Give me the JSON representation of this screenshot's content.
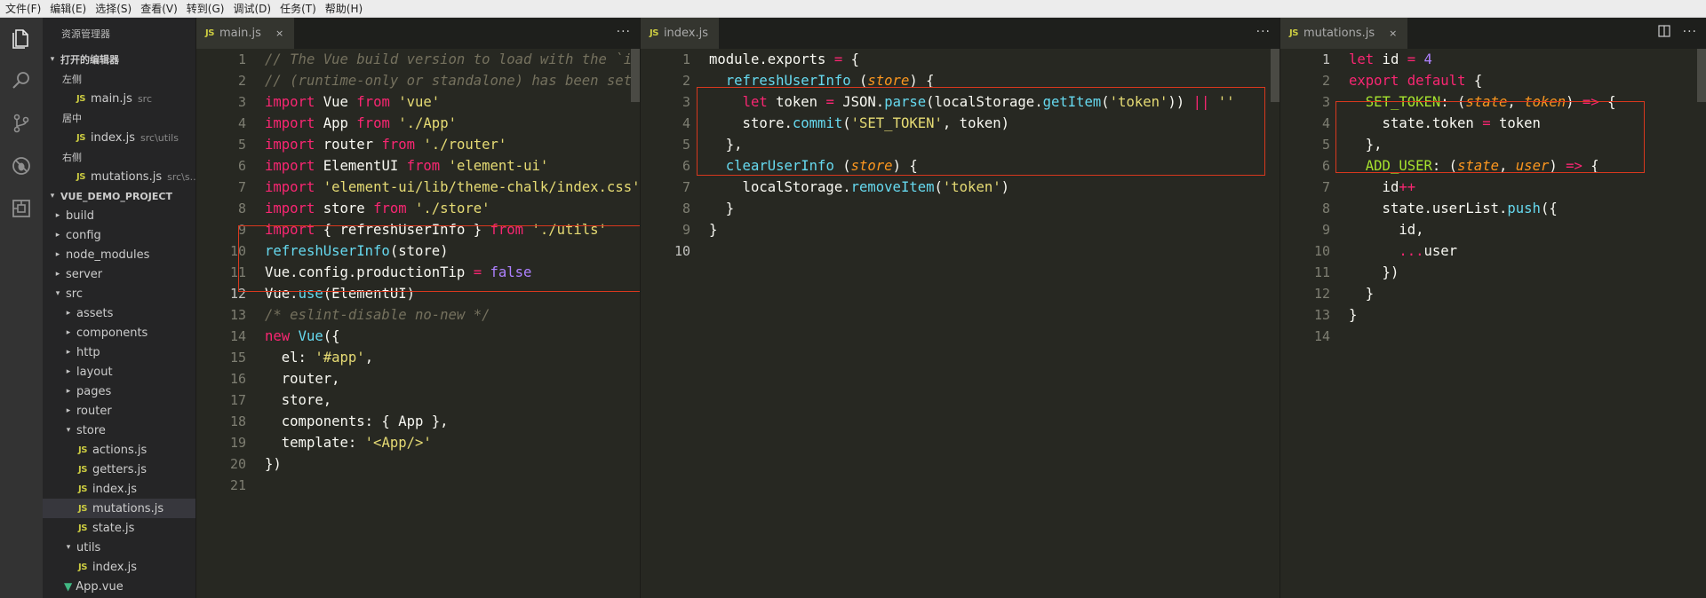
{
  "menu": [
    "文件(F)",
    "编辑(E)",
    "选择(S)",
    "查看(V)",
    "转到(G)",
    "调试(D)",
    "任务(T)",
    "帮助(H)"
  ],
  "activity_icons": [
    "files-icon",
    "search-icon",
    "source-control-icon",
    "debug-icon",
    "extensions-icon"
  ],
  "sidebar": {
    "title": "资源管理器",
    "open_editors_label": "打开的编辑器",
    "groups": [
      {
        "label": "左侧",
        "file": "main.js",
        "desc": "src"
      },
      {
        "label": "居中",
        "file": "index.js",
        "desc": "src\\utils"
      },
      {
        "label": "右侧",
        "file": "mutations.js",
        "desc": "src\\s..."
      }
    ],
    "project_label": "VUE_DEMO_PROJECT",
    "tree": [
      {
        "name": "build",
        "type": "folder",
        "depth": 1,
        "open": false
      },
      {
        "name": "config",
        "type": "folder",
        "depth": 1,
        "open": false
      },
      {
        "name": "node_modules",
        "type": "folder",
        "depth": 1,
        "open": false
      },
      {
        "name": "server",
        "type": "folder",
        "depth": 1,
        "open": false
      },
      {
        "name": "src",
        "type": "folder",
        "depth": 1,
        "open": true
      },
      {
        "name": "assets",
        "type": "folder",
        "depth": 2,
        "open": false
      },
      {
        "name": "components",
        "type": "folder",
        "depth": 2,
        "open": false
      },
      {
        "name": "http",
        "type": "folder",
        "depth": 2,
        "open": false
      },
      {
        "name": "layout",
        "type": "folder",
        "depth": 2,
        "open": false
      },
      {
        "name": "pages",
        "type": "folder",
        "depth": 2,
        "open": false
      },
      {
        "name": "router",
        "type": "folder",
        "depth": 2,
        "open": false
      },
      {
        "name": "store",
        "type": "folder",
        "depth": 2,
        "open": true
      },
      {
        "name": "actions.js",
        "type": "js",
        "depth": 3
      },
      {
        "name": "getters.js",
        "type": "js",
        "depth": 3
      },
      {
        "name": "index.js",
        "type": "js",
        "depth": 3
      },
      {
        "name": "mutations.js",
        "type": "js",
        "depth": 3,
        "selected": true
      },
      {
        "name": "state.js",
        "type": "js",
        "depth": 3
      },
      {
        "name": "utils",
        "type": "folder",
        "depth": 2,
        "open": true
      },
      {
        "name": "index.js",
        "type": "js",
        "depth": 3
      },
      {
        "name": "App.vue",
        "type": "vue",
        "depth": 2
      }
    ]
  },
  "editors": [
    {
      "tab": "main.js",
      "tab_close": "×",
      "current_line": 12,
      "lines": [
        [
          [
            "cm",
            "// The Vue build version to load with the `import` command"
          ]
        ],
        [
          [
            "cm",
            "// (runtime-only or standalone) has been set in webpack.base.conf with an alias."
          ]
        ],
        [
          [
            "kw",
            "import"
          ],
          [
            "pl",
            " Vue "
          ],
          [
            "kw",
            "from"
          ],
          [
            "pl",
            " "
          ],
          [
            "str",
            "'vue'"
          ]
        ],
        [
          [
            "kw",
            "import"
          ],
          [
            "pl",
            " App "
          ],
          [
            "kw",
            "from"
          ],
          [
            "pl",
            " "
          ],
          [
            "str",
            "'./App'"
          ]
        ],
        [
          [
            "kw",
            "import"
          ],
          [
            "pl",
            " router "
          ],
          [
            "kw",
            "from"
          ],
          [
            "pl",
            " "
          ],
          [
            "str",
            "'./router'"
          ]
        ],
        [
          [
            "kw",
            "import"
          ],
          [
            "pl",
            " ElementUI "
          ],
          [
            "kw",
            "from"
          ],
          [
            "pl",
            " "
          ],
          [
            "str",
            "'element-ui'"
          ]
        ],
        [
          [
            "kw",
            "import"
          ],
          [
            "pl",
            " "
          ],
          [
            "str",
            "'element-ui/lib/theme-chalk/index.css'"
          ]
        ],
        [
          [
            "kw",
            "import"
          ],
          [
            "pl",
            " store "
          ],
          [
            "kw",
            "from"
          ],
          [
            "pl",
            " "
          ],
          [
            "str",
            "'./store'"
          ]
        ],
        [
          [
            "kw",
            "import"
          ],
          [
            "pl",
            " { refreshUserInfo } "
          ],
          [
            "kw",
            "from"
          ],
          [
            "pl",
            " "
          ],
          [
            "str",
            "'./utils'"
          ]
        ],
        [
          [
            "fn",
            "refreshUserInfo"
          ],
          [
            "pl",
            "(store)"
          ]
        ],
        [
          [
            "pl",
            "Vue.config.productionTip "
          ],
          [
            "kw",
            "="
          ],
          [
            "pl",
            " "
          ],
          [
            "nm",
            "false"
          ]
        ],
        [
          [
            "pl",
            "Vue."
          ],
          [
            "fn",
            "use"
          ],
          [
            "pl",
            "(ElementUI)"
          ]
        ],
        [
          [
            "cm",
            "/* eslint-disable no-new */"
          ]
        ],
        [
          [
            "kw",
            "new"
          ],
          [
            "pl",
            " "
          ],
          [
            "fn",
            "Vue"
          ],
          [
            "pl",
            "({"
          ]
        ],
        [
          [
            "pl",
            "  el: "
          ],
          [
            "str",
            "'#app'"
          ],
          [
            "pl",
            ","
          ]
        ],
        [
          [
            "pl",
            "  router,"
          ]
        ],
        [
          [
            "pl",
            "  store,"
          ]
        ],
        [
          [
            "pl",
            "  components: { App },"
          ]
        ],
        [
          [
            "pl",
            "  template: "
          ],
          [
            "str",
            "'<App/>'"
          ]
        ],
        [
          [
            "pl",
            "})"
          ]
        ],
        []
      ]
    },
    {
      "tab": "index.js",
      "current_line": 10,
      "lines": [
        [
          [
            "pl",
            "module.exports "
          ],
          [
            "kw",
            "="
          ],
          [
            "pl",
            " {"
          ]
        ],
        [
          [
            "pl",
            "  "
          ],
          [
            "fn",
            "refreshUserInfo"
          ],
          [
            "pl",
            " ("
          ],
          [
            "pa",
            "store"
          ],
          [
            "pl",
            ") {"
          ]
        ],
        [
          [
            "pl",
            "    "
          ],
          [
            "kw",
            "let"
          ],
          [
            "pl",
            " token "
          ],
          [
            "kw",
            "="
          ],
          [
            "pl",
            " JSON."
          ],
          [
            "fn",
            "parse"
          ],
          [
            "pl",
            "(localStorage."
          ],
          [
            "fn",
            "getItem"
          ],
          [
            "pl",
            "("
          ],
          [
            "str",
            "'token'"
          ],
          [
            "pl",
            ")) "
          ],
          [
            "kw",
            "||"
          ],
          [
            "pl",
            " "
          ],
          [
            "str",
            "''"
          ]
        ],
        [
          [
            "pl",
            "    store."
          ],
          [
            "fn",
            "commit"
          ],
          [
            "pl",
            "("
          ],
          [
            "str",
            "'SET_TOKEN'"
          ],
          [
            "pl",
            ", token)"
          ]
        ],
        [
          [
            "pl",
            "  },"
          ]
        ],
        [
          [
            "pl",
            "  "
          ],
          [
            "fn",
            "clearUserInfo"
          ],
          [
            "pl",
            " ("
          ],
          [
            "pa",
            "store"
          ],
          [
            "pl",
            ") {"
          ]
        ],
        [
          [
            "pl",
            "    localStorage."
          ],
          [
            "fn",
            "removeItem"
          ],
          [
            "pl",
            "("
          ],
          [
            "str",
            "'token'"
          ],
          [
            "pl",
            ")"
          ]
        ],
        [
          [
            "pl",
            "  }"
          ]
        ],
        [
          [
            "pl",
            "}"
          ]
        ],
        []
      ]
    },
    {
      "tab": "mutations.js",
      "tab_close": "×",
      "current_line": 1,
      "lines": [
        [
          [
            "kw",
            "let"
          ],
          [
            "pl",
            " id "
          ],
          [
            "kw",
            "="
          ],
          [
            "pl",
            " "
          ],
          [
            "nm",
            "4"
          ]
        ],
        [
          [
            "kw",
            "export"
          ],
          [
            "pl",
            " "
          ],
          [
            "kw",
            "default"
          ],
          [
            "pl",
            " {"
          ]
        ],
        [
          [
            "pl",
            "  "
          ],
          [
            "ob",
            "SET_TOKEN"
          ],
          [
            "pl",
            ": ("
          ],
          [
            "pa",
            "state"
          ],
          [
            "pl",
            ", "
          ],
          [
            "pa",
            "token"
          ],
          [
            "pl",
            ") "
          ],
          [
            "kw",
            "=>"
          ],
          [
            "pl",
            " {"
          ]
        ],
        [
          [
            "pl",
            "    state.token "
          ],
          [
            "kw",
            "="
          ],
          [
            "pl",
            " token"
          ]
        ],
        [
          [
            "pl",
            "  },"
          ]
        ],
        [
          [
            "pl",
            "  "
          ],
          [
            "ob",
            "ADD_USER"
          ],
          [
            "pl",
            ": ("
          ],
          [
            "pa",
            "state"
          ],
          [
            "pl",
            ", "
          ],
          [
            "pa",
            "user"
          ],
          [
            "pl",
            ") "
          ],
          [
            "kw",
            "=>"
          ],
          [
            "pl",
            " {"
          ]
        ],
        [
          [
            "pl",
            "    id"
          ],
          [
            "kw",
            "++"
          ]
        ],
        [
          [
            "pl",
            "    state.userList."
          ],
          [
            "fn",
            "push"
          ],
          [
            "pl",
            "({"
          ]
        ],
        [
          [
            "pl",
            "      id,"
          ]
        ],
        [
          [
            "pl",
            "      "
          ],
          [
            "kw",
            "..."
          ],
          [
            "pl",
            "user"
          ]
        ],
        [
          [
            "pl",
            "    })"
          ]
        ],
        [
          [
            "pl",
            "  }"
          ]
        ],
        [
          [
            "pl",
            "}"
          ]
        ],
        []
      ]
    }
  ],
  "more_actions": "···",
  "split_icon": "split-editor-icon",
  "colors": {
    "highlight_box": "#d8381e",
    "js_badge": "#cbcb41",
    "background": "#272822"
  }
}
